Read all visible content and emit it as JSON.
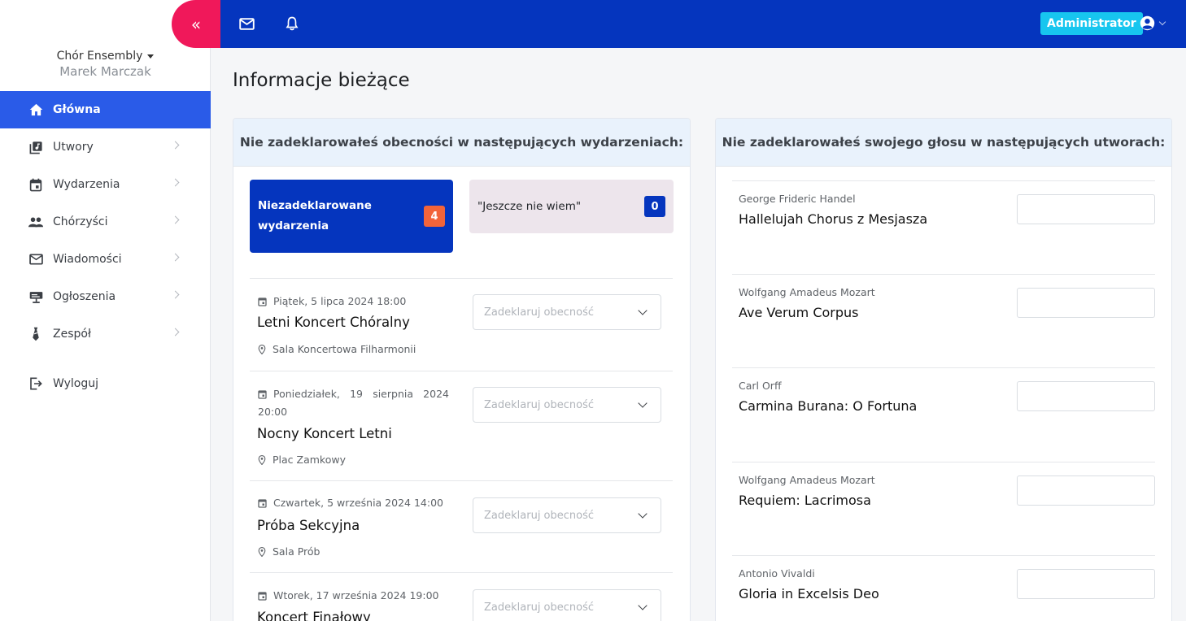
{
  "sidebar": {
    "org_name": "Chór Ensembly",
    "user_name": "Marek Marczak",
    "collapse_glyph": "«",
    "items": [
      {
        "label": "Główna",
        "icon": "home-icon",
        "active": true
      },
      {
        "label": "Utwory",
        "icon": "library-music-icon"
      },
      {
        "label": "Wydarzenia",
        "icon": "calendar-icon"
      },
      {
        "label": "Chórzyści",
        "icon": "people-icon"
      },
      {
        "label": "Wiadomości",
        "icon": "mail-icon"
      },
      {
        "label": "Ogłoszenia",
        "icon": "announcement-icon"
      },
      {
        "label": "Zespół",
        "icon": "tie-icon"
      }
    ],
    "logout_label": "Wyloguj"
  },
  "topbar": {
    "role_badge": "Administrator"
  },
  "page": {
    "title": "Informacje bieżące"
  },
  "events_card": {
    "header": "Nie zadeklarowałeś obecności w następujących wydarzeniach:",
    "tiles": [
      {
        "label": "Niezadeklarowane wydarzenia",
        "count": "4"
      },
      {
        "label": "\"Jeszcze nie wiem\"",
        "count": "0"
      }
    ],
    "select_placeholder": "Zadeklaruj obecność",
    "events": [
      {
        "date": "Piątek, 5 lipca 2024 18:00",
        "title": "Letni Koncert Chóralny",
        "place": "Sala Koncertowa Filharmonii"
      },
      {
        "date": "Poniedziałek, 19 sierpnia 2024 20:00",
        "title": "Nocny Koncert Letni",
        "place": "Plac Zamkowy"
      },
      {
        "date": "Czwartek, 5 września 2024 14:00",
        "title": "Próba Sekcyjna",
        "place": "Sala Prób"
      },
      {
        "date": "Wtorek, 17 września 2024 19:00",
        "title": "Koncert Finałowy",
        "place": ""
      }
    ]
  },
  "pieces_card": {
    "header": "Nie zadeklarowałeś swojego głosu w następujących utworach:",
    "pieces": [
      {
        "composer": "George Frideric Handel",
        "title": "Hallelujah Chorus z Mesjasza"
      },
      {
        "composer": "Wolfgang Amadeus Mozart",
        "title": "Ave Verum Corpus"
      },
      {
        "composer": "Carl Orff",
        "title": "Carmina Burana: O Fortuna"
      },
      {
        "composer": "Wolfgang Amadeus Mozart",
        "title": "Requiem: Lacrimosa"
      },
      {
        "composer": "Antonio Vivaldi",
        "title": "Gloria in Excelsis Deo"
      }
    ]
  },
  "colors": {
    "primary": "#0535be",
    "active_nav": "#2a5be8",
    "collapse": "#f0185a",
    "badge": "#17c6ef",
    "count_orange": "#f2643a"
  }
}
